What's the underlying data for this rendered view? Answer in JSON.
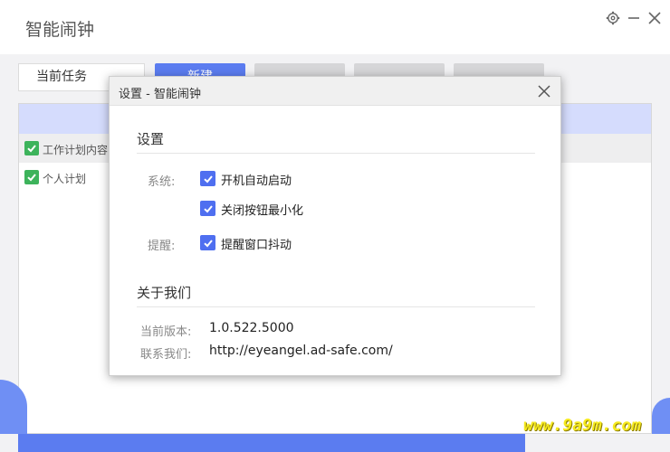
{
  "app": {
    "title": "智能闹钟"
  },
  "toolbar": {
    "current_tab": "当前任务",
    "new_label": "新建",
    "buttons_hidden": [
      "",
      "",
      ""
    ]
  },
  "task_list": {
    "rows": [
      {
        "label": "工作计划内容",
        "checked": true
      },
      {
        "label": "个人计划",
        "checked": true
      }
    ]
  },
  "dialog": {
    "title": "设置 - 智能闹钟",
    "settings_section": "设置",
    "system_label": "系统:",
    "system_options": [
      {
        "label": "开机自动启动",
        "checked": true
      },
      {
        "label": "关闭按钮最小化",
        "checked": true
      }
    ],
    "remind_label": "提醒:",
    "remind_options": [
      {
        "label": "提醒窗口抖动",
        "checked": true
      }
    ],
    "about_section": "关于我们",
    "version_label": "当前版本:",
    "version_value": "1.0.522.5000",
    "contact_label": "联系我们:",
    "contact_value": "http://eyeangel.ad-safe.com/"
  },
  "watermark": "www.9a9m.com",
  "colors": {
    "accent": "#5b7cf0",
    "checkbox": "#4f6ff0",
    "row_check": "#3db35b",
    "panel_header": "#d5dcfd",
    "watermark": "#f6ea1f"
  },
  "icons": {
    "settings": "gear-icon",
    "minimize": "minimize-icon",
    "close": "close-icon"
  }
}
